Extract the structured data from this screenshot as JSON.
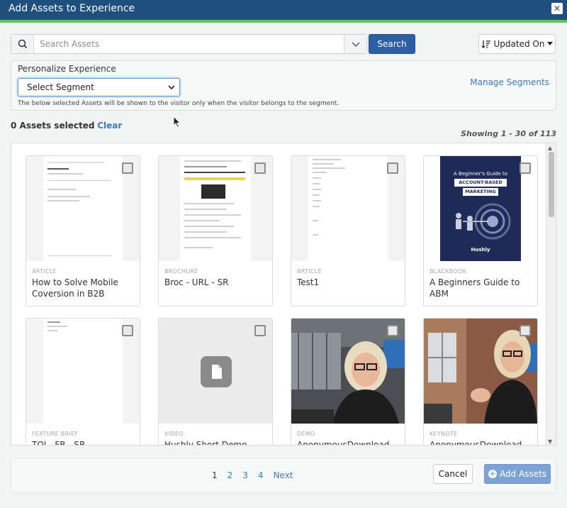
{
  "window": {
    "title": "Add Assets to Experience",
    "close_glyph": "✕"
  },
  "search": {
    "placeholder": "Search Assets",
    "button": "Search"
  },
  "sort": {
    "label": "Updated On"
  },
  "personalize": {
    "label": "Personalize Experience",
    "segment_select": "Select Segment",
    "manage_link": "Manage Segments",
    "note": "The below selected Assets will be shown to the visitor only when the visitor belongs to the segment."
  },
  "selection": {
    "count_text": "0 Assets selected",
    "clear": "Clear"
  },
  "showing": "Showing 1 - 30 of 113",
  "assets": [
    {
      "type": "ARTICLE",
      "name": "How to Solve Mobile Coversion in B2B"
    },
    {
      "type": "BROCHURE",
      "name": "Broc - URL - SR"
    },
    {
      "type": "ARTICLE",
      "name": "Test1"
    },
    {
      "type": "BLACKBOOK",
      "name": "A Beginners Guide to ABM"
    },
    {
      "type": "FEATURE BRIEF",
      "name": "TOI - FB - SR"
    },
    {
      "type": "VIDEO",
      "name": "Hushly Short Demo"
    },
    {
      "type": "DEMO",
      "name": "AnonymousDownload"
    },
    {
      "type": "KEYNOTE",
      "name": "AnonymousDownload"
    }
  ],
  "book_cover": {
    "line1": "A Beginner's Guide to",
    "banner1": "ACCOUNT-BASED",
    "banner2": "MARKETING",
    "brand": "Hushly"
  },
  "pagination": {
    "pages": [
      "1",
      "2",
      "3",
      "4"
    ],
    "next": "Next"
  },
  "footer": {
    "cancel": "Cancel",
    "add": "Add Assets"
  },
  "colors": {
    "header": "#1f4f7c",
    "accent_green": "#5fc15a",
    "primary": "#2d5fa4",
    "link": "#3a7bbf"
  }
}
